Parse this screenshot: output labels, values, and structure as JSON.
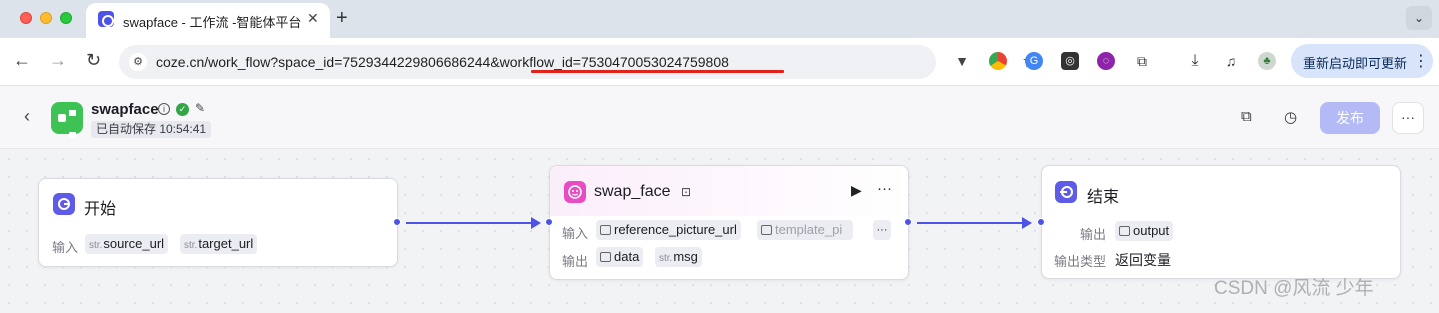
{
  "browser": {
    "tab_title": "swapface - 工作流 -智能体平台",
    "tab_close": "✕",
    "new_tab": "+",
    "tab_menu": "⌄",
    "url": "coze.cn/work_flow?space_id=7529344229806686244&workflow_id=7530470053024759808",
    "update_label": "重新启动即可更新",
    "update_menu": "⋮"
  },
  "app": {
    "name": "swapface",
    "saved_text": "已自动保存 10:54:41",
    "publish_label": "发布",
    "more_label": "···"
  },
  "nodes": {
    "start": {
      "title": "开始",
      "input_label": "输入",
      "inputs": [
        {
          "type": "str.",
          "name": "source_url"
        },
        {
          "type": "str.",
          "name": "target_url"
        }
      ]
    },
    "swap": {
      "title": "swap_face",
      "input_label": "输入",
      "inputs": [
        "reference_picture_url",
        "template_pi"
      ],
      "more_inputs": "···",
      "output_label": "输出",
      "outputs": [
        {
          "type": "img",
          "name": "data"
        },
        {
          "type": "str.",
          "name": "msg"
        }
      ],
      "run_icon": "▶",
      "menu_icon": "···"
    },
    "end": {
      "title": "结束",
      "output_label": "输出",
      "output_value": "output",
      "output_type_label": "输出类型",
      "output_type_value": "返回变量"
    }
  },
  "watermark": "CSDN @风流 少年",
  "colors": {
    "accent": "#4d53e8",
    "start_icon": "#5e5ce6",
    "swap_icon": "#e84bc4",
    "end_icon": "#5e5ce6",
    "url_underline": "#e2231a"
  }
}
